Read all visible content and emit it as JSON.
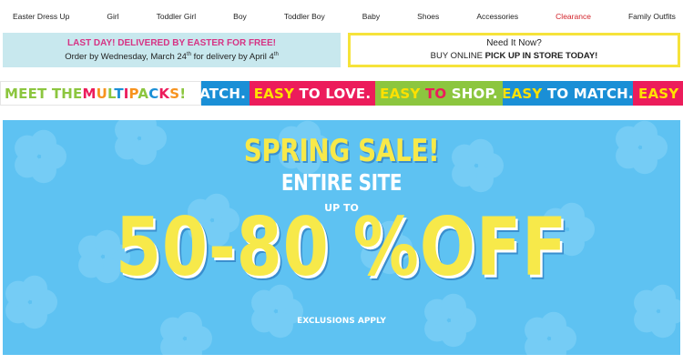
{
  "nav": {
    "items": [
      "Easter Dress Up",
      "Girl",
      "Toddler Girl",
      "Boy",
      "Toddler Boy",
      "Baby",
      "Shoes",
      "Accessories",
      "Clearance",
      "Family Outfits"
    ],
    "highlight_color": "#d2232a"
  },
  "promo_left": {
    "line1": "LAST DAY! DELIVERED BY EASTER FOR FREE!",
    "line2_a": "Order by Wednesday, March 24",
    "line2_sup1": "th",
    "line2_b": " for delivery by April 4",
    "line2_sup2": "th"
  },
  "promo_right": {
    "line1": "Need It Now?",
    "line2_a": "BUY ONLINE ",
    "line2_bold": "PICK UP IN STORE TODAY!"
  },
  "ribbon": {
    "meet": "MEET THE ",
    "multipacks": "MULTIPACKS!",
    "match_tail": "ATCH.",
    "easy": "EASY",
    "to": "TO",
    "love": "LOVE.",
    "shop": "SHOP.",
    "match": "MATCH.",
    "easy_tail": "EASY"
  },
  "hero": {
    "title": "SPRING SALE!",
    "subtitle": "ENTIRE SITE",
    "up_to": "UP TO",
    "discount": "50-80 %OFF",
    "exclusions": "EXCLUSIONS APPLY",
    "background_color": "#5ec2f2",
    "accent_color": "#f7e94a"
  }
}
